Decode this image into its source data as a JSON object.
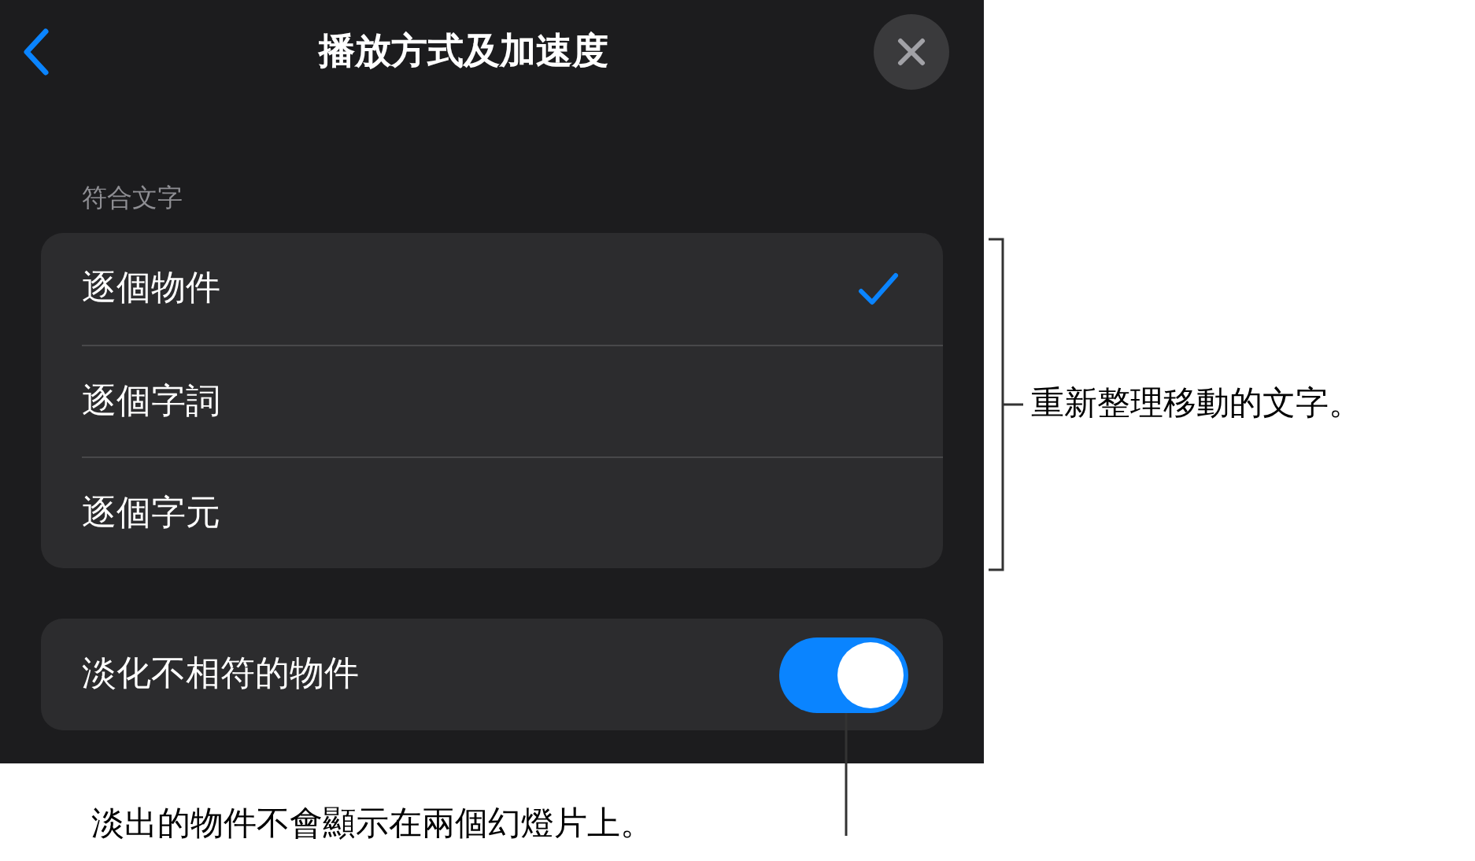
{
  "header": {
    "title": "播放方式及加速度"
  },
  "section": {
    "label": "符合文字",
    "options": [
      {
        "label": "逐個物件",
        "selected": true
      },
      {
        "label": "逐個字詞",
        "selected": false
      },
      {
        "label": "逐個字元",
        "selected": false
      }
    ]
  },
  "fade_setting": {
    "label": "淡化不相符的物件",
    "on": true
  },
  "callouts": [
    {
      "text": "重新整理移動的文字。"
    },
    {
      "text": "淡出的物件不會顯示在兩個幻燈片上。"
    }
  ]
}
